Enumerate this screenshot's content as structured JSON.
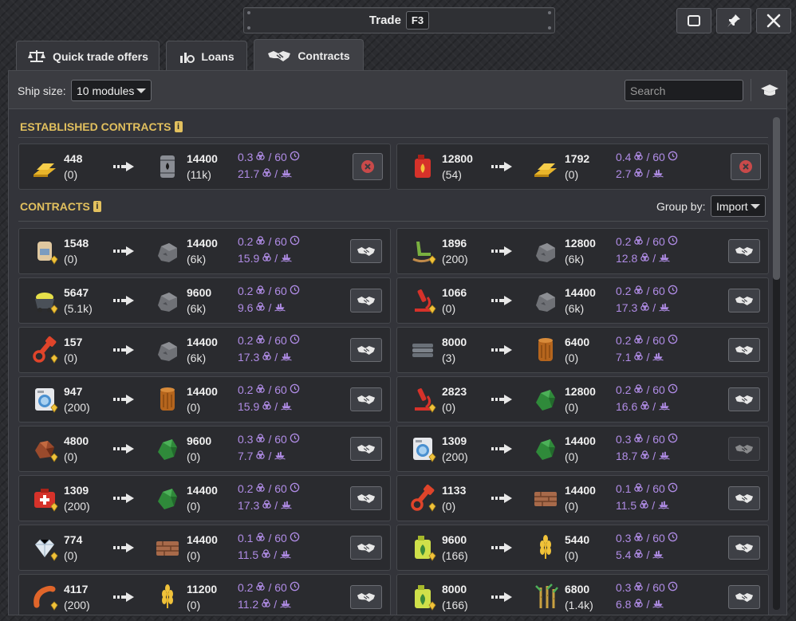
{
  "window": {
    "title": "Trade",
    "hotkey": "F3",
    "buttons": [
      "maximize-icon",
      "pin-icon",
      "close-icon"
    ]
  },
  "tabs": [
    {
      "label": "Quick trade offers",
      "icon": "scales-icon",
      "active": false
    },
    {
      "label": "Loans",
      "icon": "loan-icon",
      "active": false
    },
    {
      "label": "Contracts",
      "icon": "handshake-icon",
      "active": true
    }
  ],
  "toolbar": {
    "ship_size_label": "Ship size:",
    "ship_size_value": "10 modules",
    "search_placeholder": "Search",
    "research_icon": "graduation-cap-icon"
  },
  "established": {
    "title": "ESTABLISHED CONTRACTS",
    "info": "i",
    "items": [
      {
        "give_icon": "gold-bars-icon",
        "give_qty": "448",
        "give_have": "(0)",
        "get_icon": "oil-barrel-icon",
        "get_qty": "14400",
        "get_have": "(11k)",
        "rate": "0.3",
        "period": "/ 60",
        "upkeep": "21.7",
        "upkeep_suffix": "/",
        "action": "cancel-contract-icon"
      },
      {
        "give_icon": "fuel-canister-icon",
        "give_qty": "12800",
        "give_have": "(54)",
        "get_icon": "gold-bars-icon",
        "get_qty": "1792",
        "get_have": "(0)",
        "rate": "0.4",
        "period": "/ 60",
        "upkeep": "2.7",
        "upkeep_suffix": "/",
        "action": "cancel-contract-icon"
      }
    ]
  },
  "contracts": {
    "title": "CONTRACTS",
    "info": "i",
    "group_by_label": "Group by:",
    "group_by_value": "Import",
    "items": [
      {
        "give_icon": "cement-sack-icon",
        "give_qty": "1548",
        "give_have": "(0)",
        "get_icon": "rock-icon",
        "get_qty": "14400",
        "get_have": "(6k)",
        "rate": "0.2",
        "period": "/ 60",
        "upkeep": "15.9",
        "upkeep_suffix": "/",
        "enabled": true
      },
      {
        "give_icon": "rocking-chair-icon",
        "give_qty": "1896",
        "give_have": "(200)",
        "get_icon": "rock-icon",
        "get_qty": "12800",
        "get_have": "(6k)",
        "rate": "0.2",
        "period": "/ 60",
        "upkeep": "12.8",
        "upkeep_suffix": "/",
        "enabled": true
      },
      {
        "give_icon": "mine-cart-icon",
        "give_qty": "5647",
        "give_have": "(5.1k)",
        "get_icon": "rock-icon",
        "get_qty": "9600",
        "get_have": "(6k)",
        "rate": "0.2",
        "period": "/ 60",
        "upkeep": "9.6",
        "upkeep_suffix": "/",
        "enabled": true
      },
      {
        "give_icon": "microscope-icon",
        "give_qty": "1066",
        "give_have": "(0)",
        "get_icon": "rock-icon",
        "get_qty": "14400",
        "get_have": "(6k)",
        "rate": "0.2",
        "period": "/ 60",
        "upkeep": "17.3",
        "upkeep_suffix": "/",
        "enabled": true
      },
      {
        "give_icon": "piston-icon",
        "give_qty": "157",
        "give_have": "(0)",
        "get_icon": "rock-icon",
        "get_qty": "14400",
        "get_have": "(6k)",
        "rate": "0.2",
        "period": "/ 60",
        "upkeep": "17.3",
        "upkeep_suffix": "/",
        "enabled": true
      },
      {
        "give_icon": "steel-pipes-icon",
        "give_qty": "8000",
        "give_have": "(3)",
        "get_icon": "wood-log-icon",
        "get_qty": "6400",
        "get_have": "(0)",
        "rate": "0.2",
        "period": "/ 60",
        "upkeep": "7.1",
        "upkeep_suffix": "/",
        "enabled": true
      },
      {
        "give_icon": "washing-machine-icon",
        "give_qty": "947",
        "give_have": "(200)",
        "get_icon": "wood-log-icon",
        "get_qty": "14400",
        "get_have": "(0)",
        "rate": "0.2",
        "period": "/ 60",
        "upkeep": "15.9",
        "upkeep_suffix": "/",
        "enabled": true
      },
      {
        "give_icon": "microscope-icon",
        "give_qty": "2823",
        "give_have": "(0)",
        "get_icon": "green-ore-icon",
        "get_qty": "12800",
        "get_have": "(0)",
        "rate": "0.2",
        "period": "/ 60",
        "upkeep": "16.6",
        "upkeep_suffix": "/",
        "enabled": true
      },
      {
        "give_icon": "copper-ore-icon",
        "give_qty": "4800",
        "give_have": "(0)",
        "get_icon": "green-ore-icon",
        "get_qty": "9600",
        "get_have": "(0)",
        "rate": "0.3",
        "period": "/ 60",
        "upkeep": "7.7",
        "upkeep_suffix": "/",
        "enabled": true
      },
      {
        "give_icon": "washing-machine-icon",
        "give_qty": "1309",
        "give_have": "(200)",
        "get_icon": "green-ore-icon",
        "get_qty": "14400",
        "get_have": "(0)",
        "rate": "0.3",
        "period": "/ 60",
        "upkeep": "18.7",
        "upkeep_suffix": "/",
        "enabled": false
      },
      {
        "give_icon": "medkit-icon",
        "give_qty": "1309",
        "give_have": "(200)",
        "get_icon": "green-ore-icon",
        "get_qty": "14400",
        "get_have": "(0)",
        "rate": "0.2",
        "period": "/ 60",
        "upkeep": "17.3",
        "upkeep_suffix": "/",
        "enabled": true
      },
      {
        "give_icon": "piston-icon",
        "give_qty": "1133",
        "give_have": "(0)",
        "get_icon": "brick-crate-icon",
        "get_qty": "14400",
        "get_have": "(0)",
        "rate": "0.1",
        "period": "/ 60",
        "upkeep": "11.5",
        "upkeep_suffix": "/",
        "enabled": true
      },
      {
        "give_icon": "diamond-icon",
        "give_qty": "774",
        "give_have": "(0)",
        "get_icon": "brick-crate-icon",
        "get_qty": "14400",
        "get_have": "(0)",
        "rate": "0.1",
        "period": "/ 60",
        "upkeep": "11.5",
        "upkeep_suffix": "/",
        "enabled": true
      },
      {
        "give_icon": "fertilizer-canister-icon",
        "give_qty": "9600",
        "give_have": "(166)",
        "get_icon": "wheat-icon",
        "get_qty": "5440",
        "get_have": "(0)",
        "rate": "0.3",
        "period": "/ 60",
        "upkeep": "5.4",
        "upkeep_suffix": "/",
        "enabled": true
      },
      {
        "give_icon": "sausage-icon",
        "give_qty": "4117",
        "give_have": "(200)",
        "get_icon": "wheat-icon",
        "get_qty": "11200",
        "get_have": "(0)",
        "rate": "0.2",
        "period": "/ 60",
        "upkeep": "11.2",
        "upkeep_suffix": "/",
        "enabled": true
      },
      {
        "give_icon": "fertilizer-canister-icon",
        "give_qty": "8000",
        "give_have": "(166)",
        "get_icon": "sugarcane-icon",
        "get_qty": "6800",
        "get_have": "(1.4k)",
        "rate": "0.3",
        "period": "/ 60",
        "upkeep": "6.8",
        "upkeep_suffix": "/",
        "enabled": true
      }
    ]
  },
  "colors": {
    "accent_gold": "#e2c05e",
    "stat_purple": "#b08ce6",
    "cancel_red": "#c94a4a"
  }
}
